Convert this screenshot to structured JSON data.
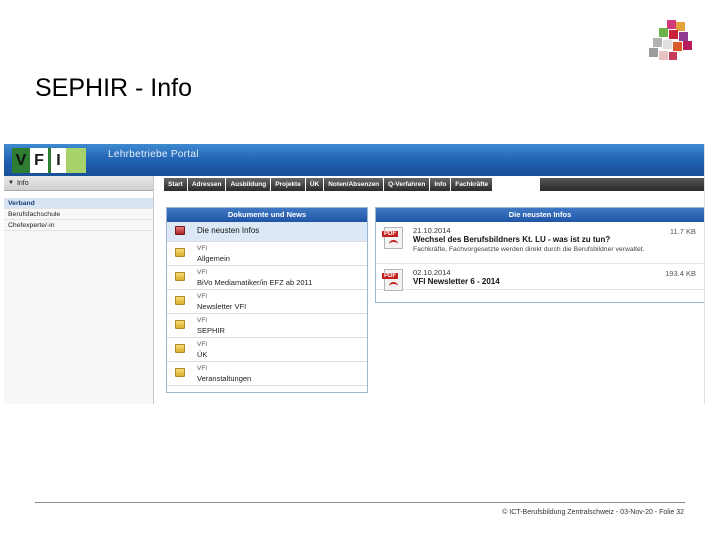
{
  "slide": {
    "title": "SEPHIR - Info",
    "footer": "© ICT-Berufsbildung Zentralschweiz - 03-Nov-20 - Folie 32"
  },
  "portal": {
    "logo_letters": [
      "V",
      "F",
      "I"
    ],
    "name": "Lehrbetriebe Portal",
    "sidebar": {
      "header": "Info",
      "items": [
        {
          "label": "Verband",
          "active": true
        },
        {
          "label": "Berufsfachschule",
          "active": false
        },
        {
          "label": "Chefexperte/-in",
          "active": false
        }
      ]
    },
    "nav": [
      "Start",
      "Adressen",
      "Ausbildung",
      "Projekte",
      "ÜK",
      "Noten/Absenzen",
      "Q-Verfahren",
      "Info",
      "Fachkräfte"
    ],
    "docs_panel": {
      "title": "Dokumente und News",
      "rows": [
        {
          "category": "",
          "name": "Die neusten Infos",
          "selected": true,
          "icon": "folder-red-icon"
        },
        {
          "category": "VFI",
          "name": "Allgemein",
          "selected": false,
          "icon": "folder-icon"
        },
        {
          "category": "VFI",
          "name": "BiVo Mediamatiker/in EFZ ab 2011",
          "selected": false,
          "icon": "folder-icon"
        },
        {
          "category": "VFI",
          "name": "Newsletter VFI",
          "selected": false,
          "icon": "folder-icon"
        },
        {
          "category": "VFI",
          "name": "SEPHIR",
          "selected": false,
          "icon": "folder-icon"
        },
        {
          "category": "VFI",
          "name": "ÜK",
          "selected": false,
          "icon": "folder-icon"
        },
        {
          "category": "VFI",
          "name": "Veranstaltungen",
          "selected": false,
          "icon": "folder-icon"
        }
      ]
    },
    "news_panel": {
      "title": "Die neusten Infos",
      "items": [
        {
          "date": "21.10.2014",
          "title": "Wechsel des Berufsbildners Kt. LU - was ist zu tun?",
          "desc": "Fachkräfte, Fachvorgesetzte werden direkt durch die Berufsbildner verwaltet.",
          "size": "11.7 KB"
        },
        {
          "date": "02.10.2014",
          "title": "VFI Newsletter 6 - 2014",
          "desc": "",
          "size": "193.4 KB"
        }
      ]
    },
    "colors": {
      "banner": "#1f5fb0",
      "panel_head": "#2a62b2",
      "selected_row": "#dde8f7"
    }
  }
}
